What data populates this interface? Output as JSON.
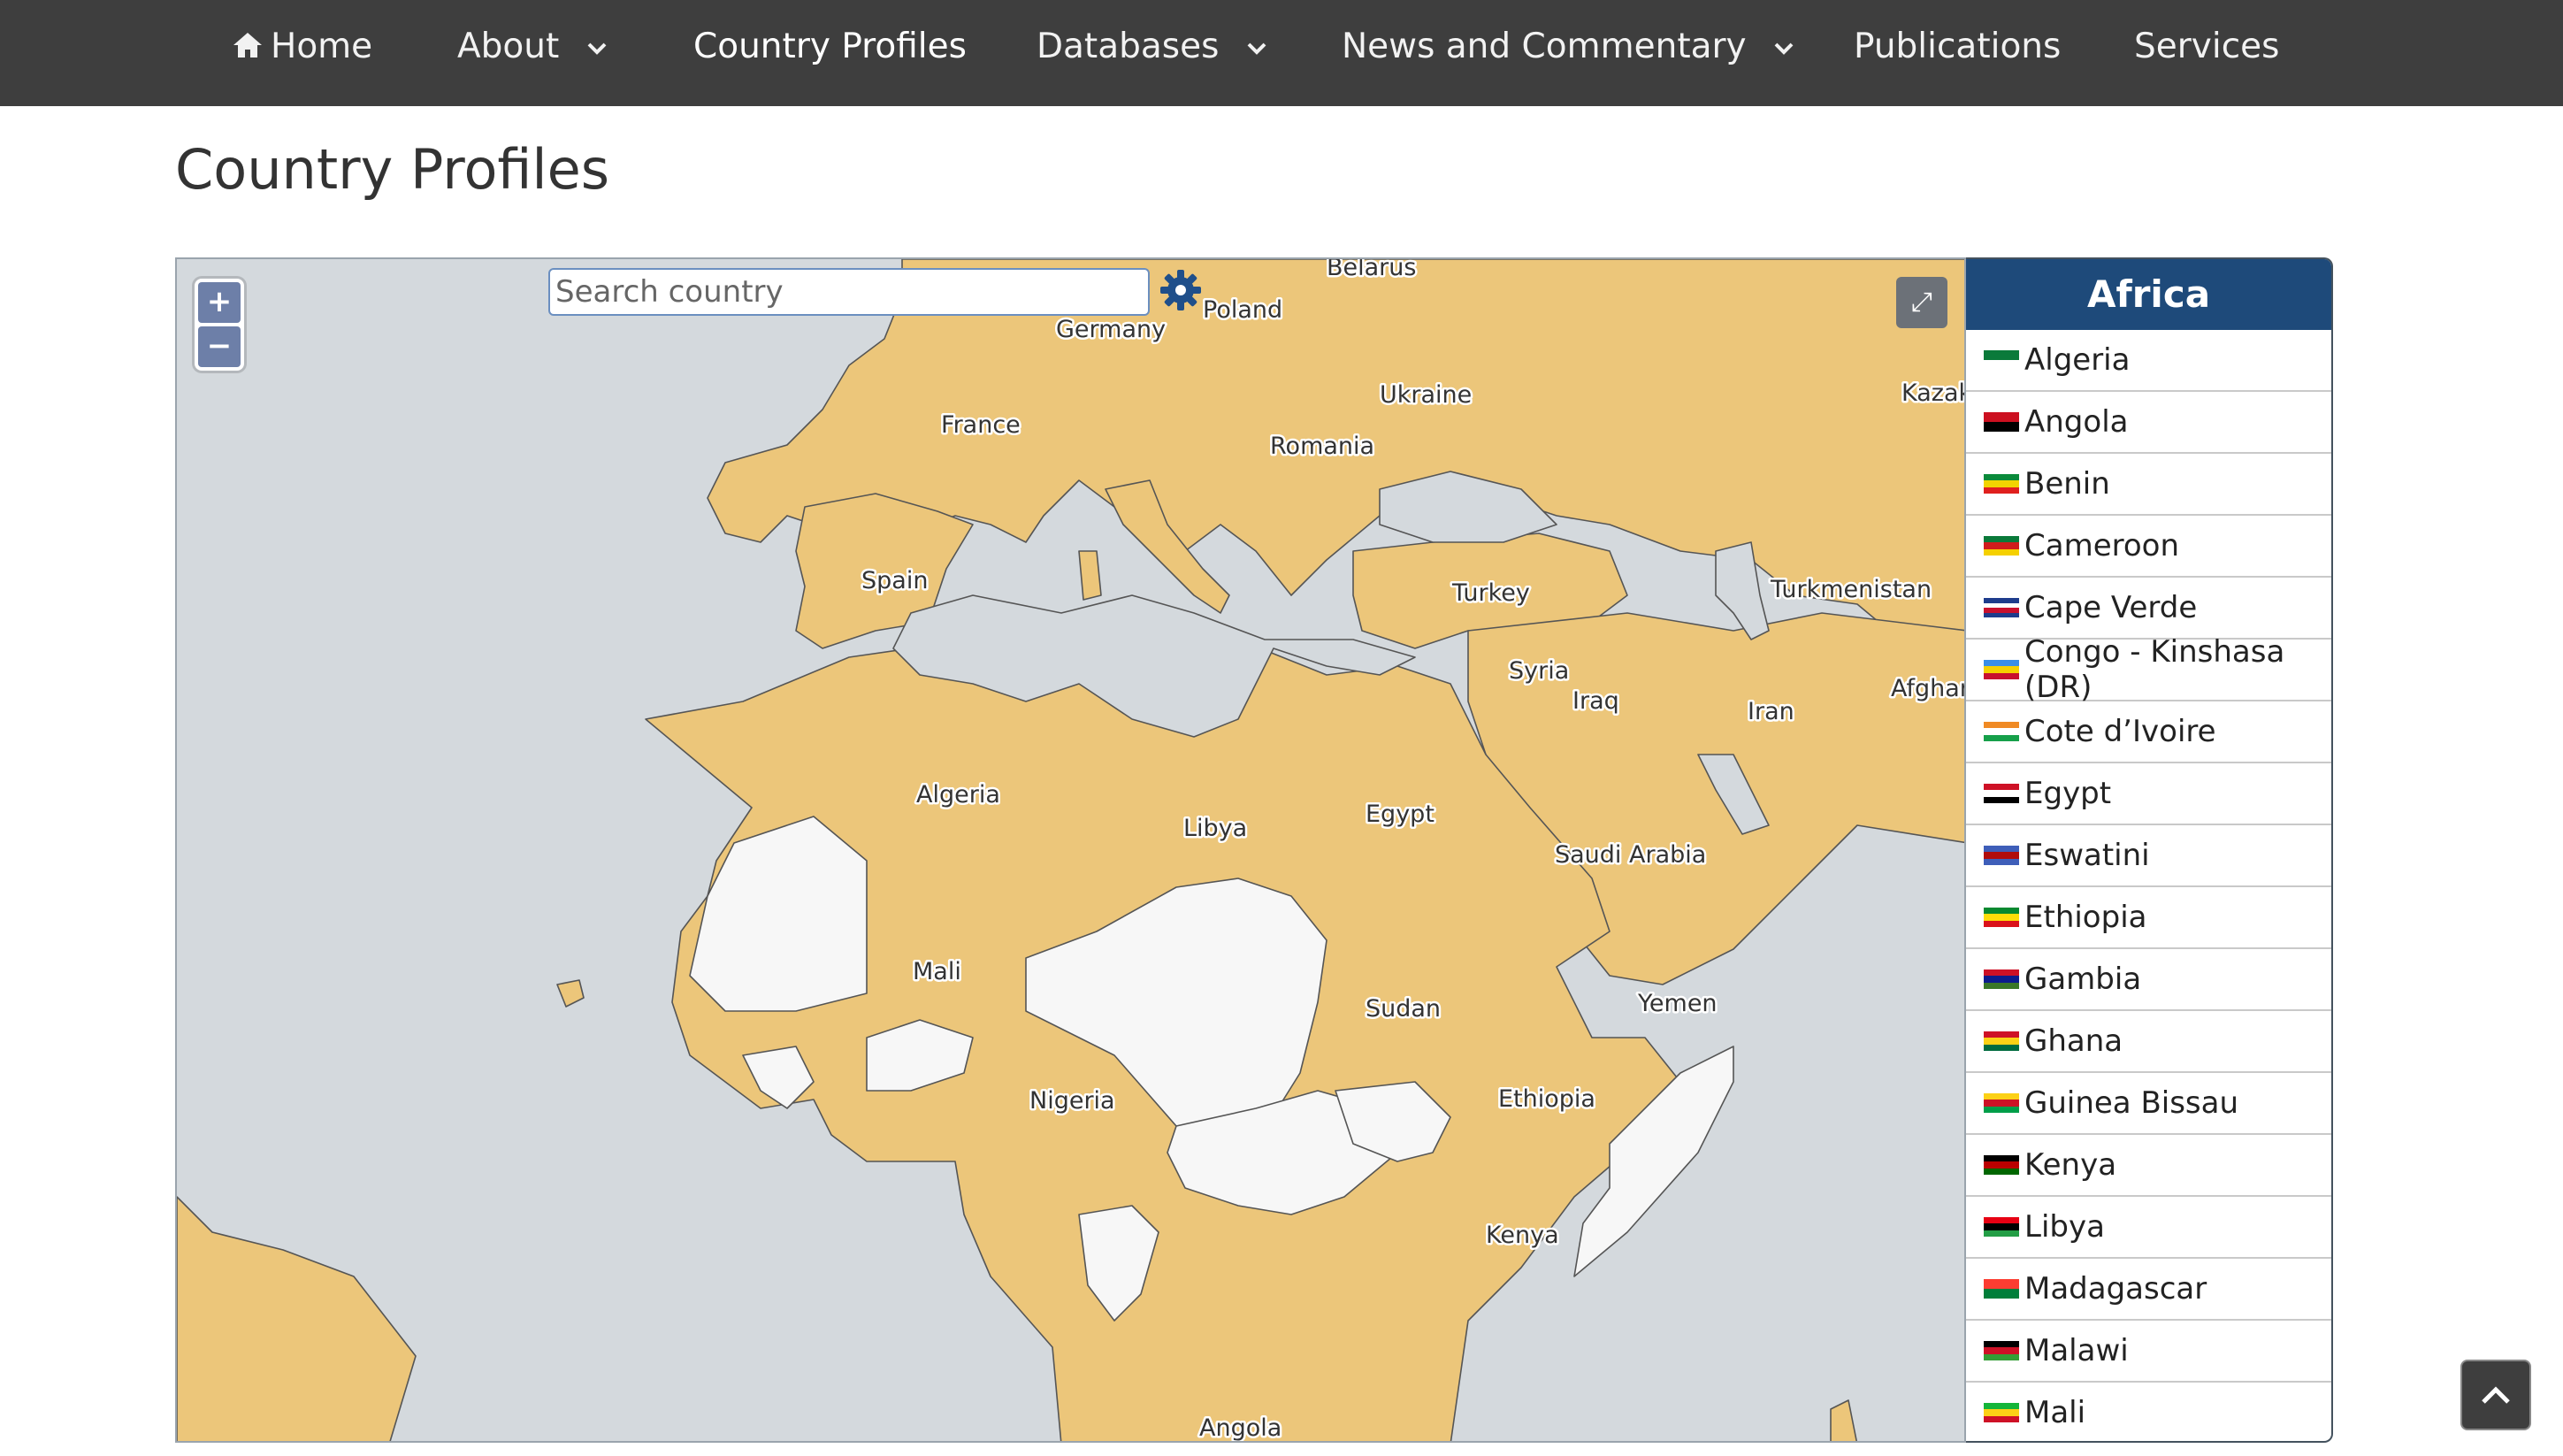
{
  "nav": {
    "home": "Home",
    "about": "About",
    "country_profiles": "Country Profiles",
    "databases": "Databases",
    "news": "News and Commentary",
    "publications": "Publications",
    "services": "Services"
  },
  "page_title": "Country Profiles",
  "map": {
    "search_placeholder": "Search country",
    "zoom_in": "+",
    "zoom_out": "−",
    "fullscreen": "⤢",
    "colors": {
      "water": "#d4d9dd",
      "profiled": "#ecc67a",
      "not_profiled": "#f7f7f7",
      "border": "#555555"
    },
    "labels": {
      "belarus": "Belarus",
      "poland": "Poland",
      "germany": "Germany",
      "ukraine": "Ukraine",
      "kazakhstan": "Kazak",
      "france": "France",
      "romania": "Romania",
      "spain": "Spain",
      "turkey": "Turkey",
      "turkmenistan": "Turkmenistan",
      "syria": "Syria",
      "iraq": "Iraq",
      "iran": "Iran",
      "afghanistan": "Afghan",
      "algeria": "Algeria",
      "libya": "Libya",
      "egypt": "Egypt",
      "saudi_arabia": "Saudi Arabia",
      "mali": "Mali",
      "sudan": "Sudan",
      "yemen": "Yemen",
      "nigeria": "Nigeria",
      "ethiopia": "Ethiopia",
      "kenya": "Kenya",
      "angola": "Angola"
    }
  },
  "sidebar": {
    "region": "Africa",
    "countries": [
      {
        "name": "Algeria",
        "flag": [
          "#0a7a3a",
          "#ffffff"
        ]
      },
      {
        "name": "Angola",
        "flag": [
          "#cc1020",
          "#000000"
        ]
      },
      {
        "name": "Benin",
        "flag": [
          "#0a8a3a",
          "#f2d400",
          "#e0201e"
        ]
      },
      {
        "name": "Cameroon",
        "flag": [
          "#0a7a3a",
          "#d01c1c",
          "#f5d000"
        ]
      },
      {
        "name": "Cape Verde",
        "flag": [
          "#1e3c8c",
          "#ffffff",
          "#c8102e",
          "#1e3c8c"
        ]
      },
      {
        "name": "Congo - Kinshasa (DR)",
        "flag": [
          "#3a8ee6",
          "#f5d000",
          "#c8102e"
        ]
      },
      {
        "name": "Cote d’Ivoire",
        "flag": [
          "#f08a24",
          "#ffffff",
          "#16a04a"
        ]
      },
      {
        "name": "Egypt",
        "flag": [
          "#ce1126",
          "#ffffff",
          "#000000"
        ]
      },
      {
        "name": "Eswatini",
        "flag": [
          "#3e5eb9",
          "#b10c0c",
          "#3e5eb9"
        ]
      },
      {
        "name": "Ethiopia",
        "flag": [
          "#078930",
          "#fcdd09",
          "#da121a"
        ]
      },
      {
        "name": "Gambia",
        "flag": [
          "#ce1126",
          "#0c1c8c",
          "#3a7728"
        ]
      },
      {
        "name": "Ghana",
        "flag": [
          "#ce1126",
          "#fcd116",
          "#006b3f"
        ]
      },
      {
        "name": "Guinea Bissau",
        "flag": [
          "#fcd116",
          "#ce1126",
          "#009e49"
        ]
      },
      {
        "name": "Kenya",
        "flag": [
          "#000000",
          "#bb0000",
          "#006600"
        ]
      },
      {
        "name": "Libya",
        "flag": [
          "#e70013",
          "#000000",
          "#239e46"
        ]
      },
      {
        "name": "Madagascar",
        "flag": [
          "#fc3d32",
          "#007e3a"
        ]
      },
      {
        "name": "Malawi",
        "flag": [
          "#000000",
          "#ce1126",
          "#339e35"
        ]
      },
      {
        "name": "Mali",
        "flag": [
          "#14b53a",
          "#fcd116",
          "#ce1126"
        ]
      }
    ]
  }
}
